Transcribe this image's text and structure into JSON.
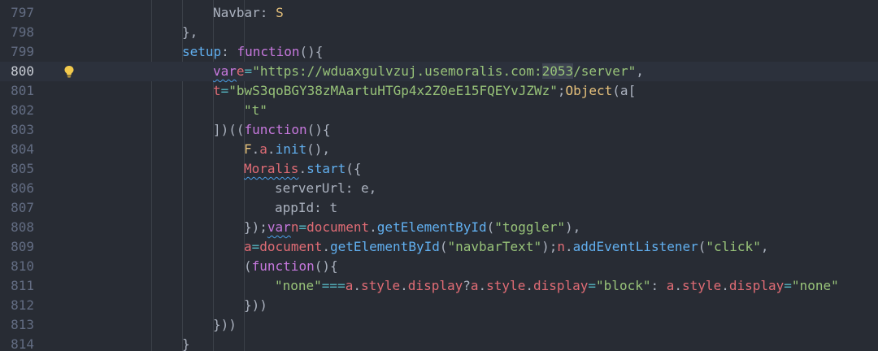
{
  "editor": {
    "lines": [
      {
        "n": "797",
        "indent": 2,
        "tokens": [
          [
            "prop",
            "Navbar"
          ],
          [
            "p",
            ": "
          ],
          [
            "type",
            "S"
          ]
        ]
      },
      {
        "n": "798",
        "indent": 1,
        "tokens": [
          [
            "p",
            "},"
          ]
        ]
      },
      {
        "n": "799",
        "indent": 1,
        "tokens": [
          [
            "fn",
            "setup"
          ],
          [
            "p",
            ": "
          ],
          [
            "kw",
            "function"
          ],
          [
            "p",
            "(){"
          ]
        ]
      },
      {
        "n": "800",
        "indent": 2,
        "current": true,
        "bulb": true,
        "tokens": [
          [
            "kw",
            "var",
            "squig"
          ],
          [
            "var",
            "e"
          ],
          [
            "op",
            "="
          ],
          [
            "str",
            "\"https://wduaxgulvzuj.usemoralis.com:"
          ],
          [
            "str",
            "2053",
            "sel"
          ],
          [
            "str",
            "/server\""
          ],
          [
            "p",
            ","
          ]
        ]
      },
      {
        "n": "801",
        "indent": 2,
        "tokens": [
          [
            "var",
            "t"
          ],
          [
            "op",
            "="
          ],
          [
            "str",
            "\"bwS3qoBGY38zMAartuHTGp4x2Z0eE15FQEYvJZWz\""
          ],
          [
            "p",
            ";"
          ],
          [
            "type",
            "Object"
          ],
          [
            "p",
            "(a["
          ]
        ]
      },
      {
        "n": "802",
        "indent": 3,
        "tokens": [
          [
            "str",
            "\"t\""
          ]
        ]
      },
      {
        "n": "803",
        "indent": 2,
        "tokens": [
          [
            "p",
            "])(("
          ],
          [
            "kw",
            "function"
          ],
          [
            "p",
            "(){"
          ]
        ]
      },
      {
        "n": "804",
        "indent": 3,
        "tokens": [
          [
            "type",
            "F"
          ],
          [
            "p",
            "."
          ],
          [
            "var",
            "a"
          ],
          [
            "p",
            "."
          ],
          [
            "fn",
            "init"
          ],
          [
            "p",
            "(),"
          ]
        ]
      },
      {
        "n": "805",
        "indent": 3,
        "tokens": [
          [
            "var",
            "Moralis",
            "squig"
          ],
          [
            "p",
            "."
          ],
          [
            "fn",
            "start"
          ],
          [
            "p",
            "({"
          ]
        ]
      },
      {
        "n": "806",
        "indent": 4,
        "tokens": [
          [
            "prop",
            "serverUrl"
          ],
          [
            "p",
            ": "
          ],
          [
            "prop",
            "e"
          ],
          [
            "p",
            ","
          ]
        ]
      },
      {
        "n": "807",
        "indent": 4,
        "tokens": [
          [
            "prop",
            "appId"
          ],
          [
            "p",
            ": "
          ],
          [
            "prop",
            "t"
          ]
        ]
      },
      {
        "n": "808",
        "indent": 3,
        "tokens": [
          [
            "p",
            "});"
          ],
          [
            "kw",
            "var",
            "squig"
          ],
          [
            "var",
            "n"
          ],
          [
            "op",
            "="
          ],
          [
            "var",
            "document"
          ],
          [
            "p",
            "."
          ],
          [
            "fn",
            "getElementById"
          ],
          [
            "p",
            "("
          ],
          [
            "str",
            "\"toggler\""
          ],
          [
            "p",
            "),"
          ]
        ]
      },
      {
        "n": "809",
        "indent": 3,
        "tokens": [
          [
            "var",
            "a"
          ],
          [
            "op",
            "="
          ],
          [
            "var",
            "document"
          ],
          [
            "p",
            "."
          ],
          [
            "fn",
            "getElementById"
          ],
          [
            "p",
            "("
          ],
          [
            "str",
            "\"navbarText\""
          ],
          [
            "p",
            ");"
          ],
          [
            "var",
            "n"
          ],
          [
            "p",
            "."
          ],
          [
            "fn",
            "addEventListener"
          ],
          [
            "p",
            "("
          ],
          [
            "str",
            "\"click\""
          ],
          [
            "p",
            ","
          ]
        ]
      },
      {
        "n": "810",
        "indent": 3,
        "tokens": [
          [
            "p",
            "("
          ],
          [
            "kw",
            "function"
          ],
          [
            "p",
            "(){"
          ]
        ]
      },
      {
        "n": "811",
        "indent": 4,
        "tokens": [
          [
            "str",
            "\"none\""
          ],
          [
            "op",
            "==="
          ],
          [
            "var",
            "a"
          ],
          [
            "p",
            "."
          ],
          [
            "var",
            "style"
          ],
          [
            "p",
            "."
          ],
          [
            "var",
            "display"
          ],
          [
            "p",
            "?"
          ],
          [
            "var",
            "a"
          ],
          [
            "p",
            "."
          ],
          [
            "var",
            "style"
          ],
          [
            "p",
            "."
          ],
          [
            "var",
            "display"
          ],
          [
            "op",
            "="
          ],
          [
            "str",
            "\"block\""
          ],
          [
            "p",
            ": "
          ],
          [
            "var",
            "a"
          ],
          [
            "p",
            "."
          ],
          [
            "var",
            "style"
          ],
          [
            "p",
            "."
          ],
          [
            "var",
            "display"
          ],
          [
            "op",
            "="
          ],
          [
            "str",
            "\"none\""
          ]
        ]
      },
      {
        "n": "812",
        "indent": 3,
        "tokens": [
          [
            "p",
            "}))"
          ]
        ]
      },
      {
        "n": "813",
        "indent": 2,
        "tokens": [
          [
            "p",
            "}))"
          ]
        ]
      },
      {
        "n": "814",
        "indent": 1,
        "tokens": [
          [
            "p",
            "}"
          ]
        ]
      }
    ]
  },
  "icons": {
    "bulb": "lightbulb-icon"
  },
  "colors": {
    "background": "#282c34",
    "current_line": "#2c313c",
    "line_number": "#636d83",
    "string": "#98c379",
    "keyword": "#c678dd",
    "function": "#61afef",
    "variable": "#e06c75",
    "type": "#e5c07b",
    "operator": "#56b6c2"
  }
}
